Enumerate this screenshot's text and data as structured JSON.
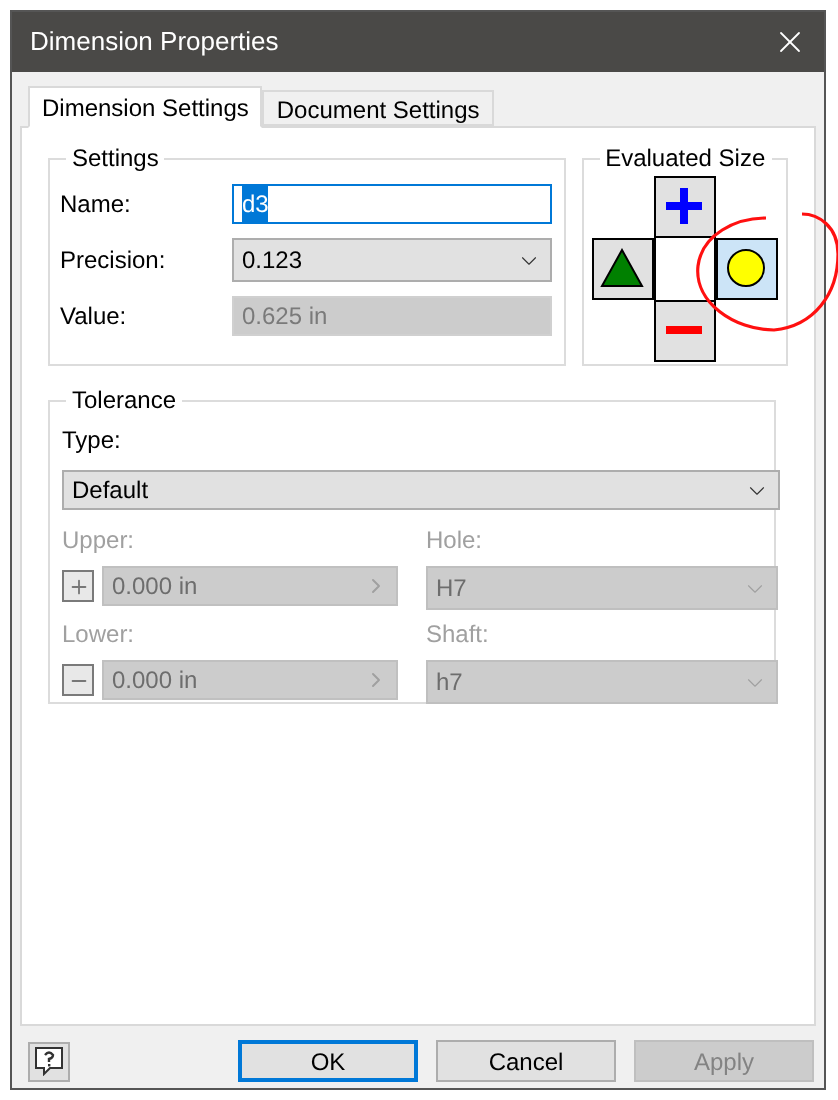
{
  "window": {
    "title": "Dimension Properties"
  },
  "tabs": [
    {
      "label": "Dimension Settings",
      "selected": true
    },
    {
      "label": "Document Settings",
      "selected": false
    }
  ],
  "settings": {
    "title": "Settings",
    "name_label": "Name:",
    "name_value": "d3",
    "name_text_selected": true,
    "precision_label": "Precision:",
    "precision_value": "0.123",
    "value_label": "Value:",
    "value_value": "0.625 in",
    "value_disabled": true
  },
  "evaluated_size": {
    "title": "Evaluated Size",
    "options": [
      {
        "kind": "upper",
        "selected": false
      },
      {
        "kind": "nominal",
        "selected": false
      },
      {
        "kind": "median",
        "selected": true
      },
      {
        "kind": "lower",
        "selected": false
      }
    ]
  },
  "tolerance": {
    "title": "Tolerance",
    "type_label": "Type:",
    "type_value": "Default",
    "disabled": true,
    "upper_label": "Upper:",
    "upper_value": "0.000 in",
    "hole_label": "Hole:",
    "hole_value": "H7",
    "lower_label": "Lower:",
    "lower_value": "0.000 in",
    "shaft_label": "Shaft:",
    "shaft_value": "h7"
  },
  "buttons": [
    {
      "label": "OK",
      "default": true,
      "disabled": false
    },
    {
      "label": "Cancel",
      "default": false,
      "disabled": false
    },
    {
      "label": "Apply",
      "default": false,
      "disabled": true
    }
  ]
}
